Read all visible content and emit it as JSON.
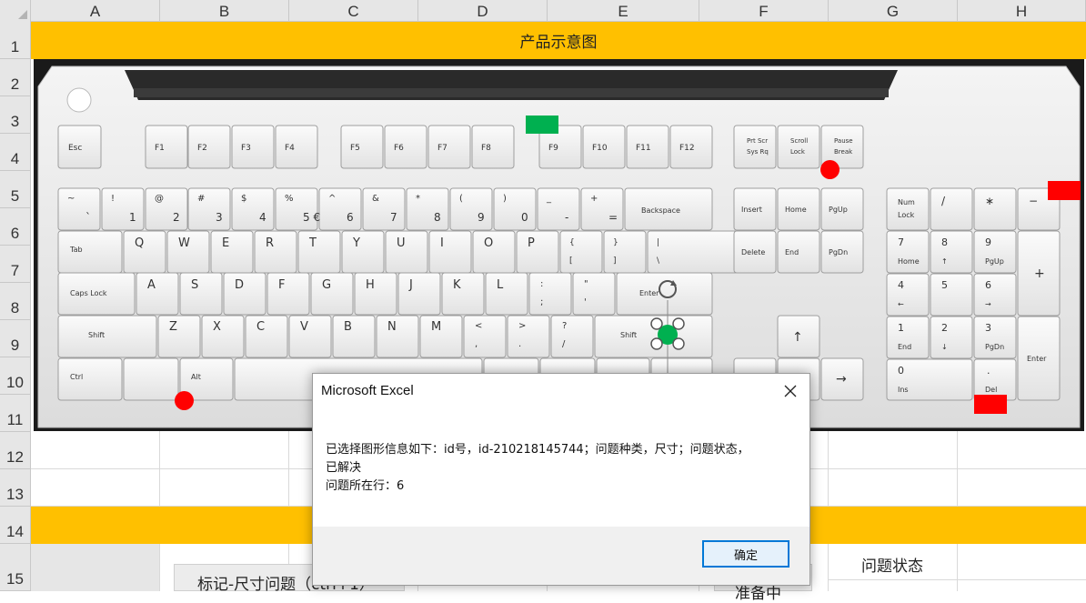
{
  "sheet": {
    "columns": [
      "A",
      "B",
      "C",
      "D",
      "E",
      "F",
      "G",
      "H"
    ],
    "rows": [
      "1",
      "2",
      "3",
      "4",
      "5",
      "6",
      "7",
      "8",
      "9",
      "10",
      "11",
      "12",
      "13",
      "14",
      "15"
    ],
    "title": "产品示意图",
    "cell_b15": "标记-尺寸问题（ctrl+1）",
    "cell_f15": "准备中",
    "cell_g15": "问题状态"
  },
  "keyboard": {
    "fkeys": [
      "Esc",
      "F1",
      "F2",
      "F3",
      "F4",
      "F5",
      "F6",
      "F7",
      "F8",
      "F9",
      "F10",
      "F11",
      "F12"
    ],
    "sys_keys": [
      [
        "Prt Scr",
        "Sys Rq"
      ],
      [
        "Scroll",
        "Lock"
      ],
      [
        "Pause",
        "Break"
      ]
    ],
    "num_row": [
      [
        "~",
        "`"
      ],
      [
        "!",
        "1"
      ],
      [
        "@",
        "2"
      ],
      [
        "#",
        "3"
      ],
      [
        "$",
        "4"
      ],
      [
        "%",
        "5 €"
      ],
      [
        "^",
        "6"
      ],
      [
        "&",
        "7"
      ],
      [
        "*",
        "8"
      ],
      [
        "(",
        "9"
      ],
      [
        ")",
        "0"
      ],
      [
        "_",
        "-"
      ],
      [
        "+",
        "="
      ]
    ],
    "backspace": "Backspace",
    "tab": "Tab",
    "q_row": [
      "Q",
      "W",
      "E",
      "R",
      "T",
      "Y",
      "U",
      "I",
      "O",
      "P"
    ],
    "q_row_extra": [
      [
        "{",
        "["
      ],
      [
        "}",
        "]"
      ],
      [
        "|",
        "\\"
      ]
    ],
    "caps": "Caps Lock",
    "a_row": [
      "A",
      "S",
      "D",
      "F",
      "G",
      "H",
      "J",
      "K",
      "L"
    ],
    "a_row_extra": [
      [
        ":",
        ";"
      ],
      [
        "\"",
        "'"
      ]
    ],
    "enter": "Enter",
    "shift": "Shift",
    "z_row": [
      "Z",
      "X",
      "C",
      "V",
      "B",
      "N",
      "M"
    ],
    "z_row_extra": [
      [
        "<",
        ","
      ],
      [
        ">",
        "."
      ],
      [
        "?",
        "/"
      ]
    ],
    "ctrl": "Ctrl",
    "alt": "Alt",
    "nav_keys": [
      [
        "Insert",
        "Home",
        "PgUp"
      ],
      [
        "Delete",
        "End",
        "PgDn"
      ]
    ],
    "numpad": {
      "row1": [
        [
          "Num",
          "Lock"
        ],
        [
          "/",
          ""
        ],
        [
          "∗",
          ""
        ],
        [
          "−",
          ""
        ]
      ],
      "row2": [
        [
          "7",
          "Home"
        ],
        [
          "8",
          "↑"
        ],
        [
          "9",
          "PgUp"
        ]
      ],
      "row3": [
        [
          "4",
          "←"
        ],
        [
          "5",
          ""
        ],
        [
          "6",
          "→"
        ]
      ],
      "row4": [
        [
          "1",
          "End"
        ],
        [
          "2",
          "↓"
        ],
        [
          "3",
          "PgDn"
        ]
      ],
      "row5": [
        [
          "0",
          "Ins"
        ],
        [
          ".",
          "Del"
        ]
      ],
      "plus": "+",
      "enter": "Enter"
    }
  },
  "dialog": {
    "title": "Microsoft Excel",
    "message_line1": "已选择图形信息如下：id号，id-210218145744；问题种类，尺寸；问题状态，",
    "message_line2": "已解决",
    "message_line3": "问题所在行：6",
    "ok_label": "确定"
  },
  "colors": {
    "band": "#ffc000",
    "marker_red": "#ff0000",
    "marker_green": "#00b050",
    "dialog_accent": "#0078d7"
  }
}
